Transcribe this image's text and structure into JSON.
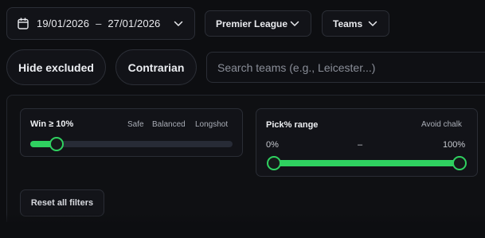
{
  "toolbar": {
    "date_start": "19/01/2026",
    "date_separator": "–",
    "date_end": "27/01/2026",
    "league": "Premier League",
    "entity": "Teams"
  },
  "filters": {
    "hide_excluded": "Hide excluded",
    "contrarian": "Contrarian",
    "search_placeholder": "Search teams (e.g., Leicester...)"
  },
  "win_card": {
    "title": "Win ≥ 10%",
    "presets": [
      "Safe",
      "Balanced",
      "Longshot"
    ],
    "value_fraction": 0.13
  },
  "pick_card": {
    "title": "Pick% range",
    "preset": "Avoid chalk",
    "min_label": "0%",
    "dash": "–",
    "max_label": "100%",
    "range": [
      0,
      100
    ]
  },
  "reset_label": "Reset all filters",
  "colors": {
    "accent": "#2fd160",
    "background": "#0d0e11",
    "track": "#272b36"
  },
  "icons": {
    "calendar": "calendar-icon",
    "dropdown": "chevron-down-icon"
  }
}
